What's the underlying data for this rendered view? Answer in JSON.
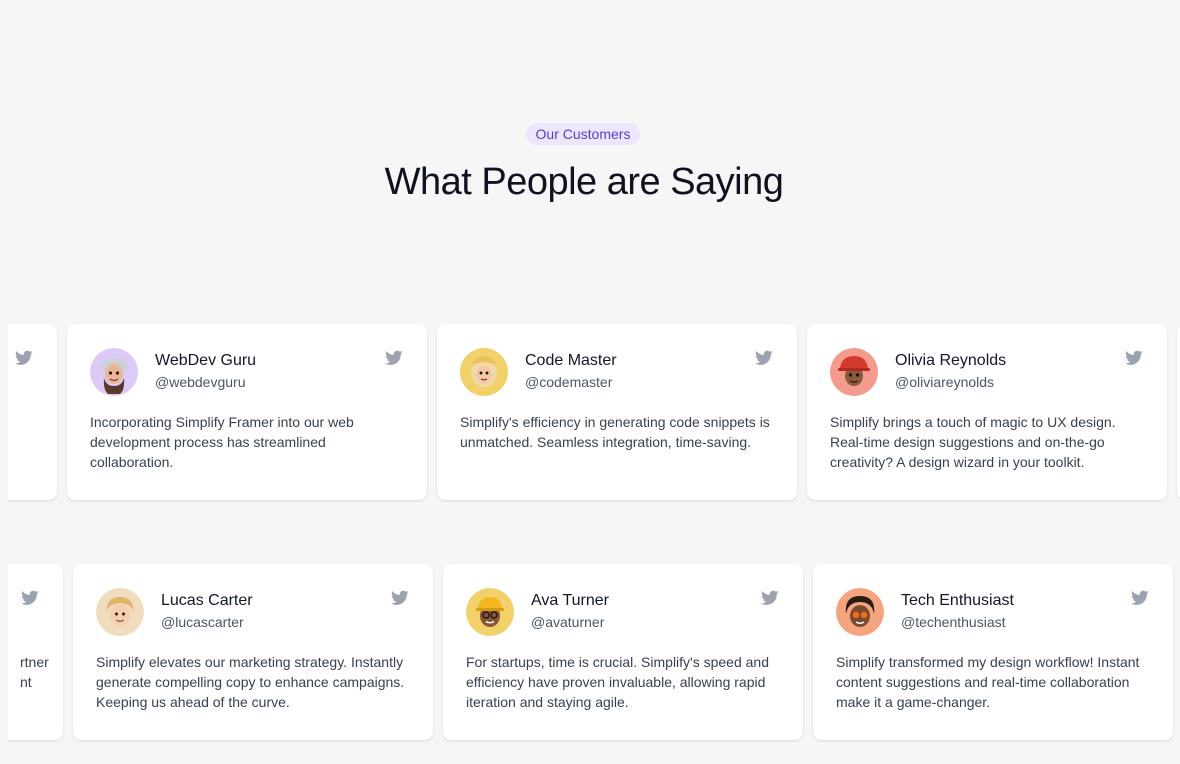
{
  "header": {
    "badge": "Our Customers",
    "title": "What People are Saying"
  },
  "colors": {
    "background": "#f6f6f6",
    "badge_bg": "#ece7ff",
    "badge_text": "#5b3ec8",
    "card_bg": "#ffffff",
    "twitter_icon": "#9ca3af"
  },
  "icons": {
    "card_icon": "twitter-bird-icon"
  },
  "row1": [
    {
      "name": "WebDev Guru",
      "handle": "@webdevguru",
      "quote": "Incorporating Simplify Framer into our web development process has streamlined collaboration.",
      "avatar_bg": "#dccbf7"
    },
    {
      "name": "Code Master",
      "handle": "@codemaster",
      "quote": "Simplify's efficiency in generating code snippets is unmatched. Seamless integration, time-saving.",
      "avatar_bg": "#f2d16b"
    },
    {
      "name": "Olivia Reynolds",
      "handle": "@oliviareynolds",
      "quote": "Simplify brings a touch of magic to UX design. Real-time design suggestions and on-the-go creativity? A design wizard in your toolkit.",
      "avatar_bg": "#f59a8f"
    }
  ],
  "row2": [
    {
      "name": "Lucas Carter",
      "handle": "@lucascarter",
      "quote": "Simplify elevates our marketing strategy. Instantly generate compelling copy to enhance campaigns. Keeping us ahead of the curve.",
      "avatar_bg": "#f1dcc0"
    },
    {
      "name": "Ava Turner",
      "handle": "@avaturner",
      "quote": "For startups, time is crucial. Simplify's speed and efficiency have proven invaluable, allowing rapid iteration and staying agile.",
      "avatar_bg": "#f2d06a"
    },
    {
      "name": "Tech Enthusiast",
      "handle": "@techenthusiast",
      "quote": "Simplify transformed my design workflow! Instant content suggestions and real-time collaboration make it a game-changer.",
      "avatar_bg": "#f4a57f"
    }
  ],
  "row2_partial_left": {
    "fragment_line1": "rtner",
    "fragment_line2": "nt"
  }
}
